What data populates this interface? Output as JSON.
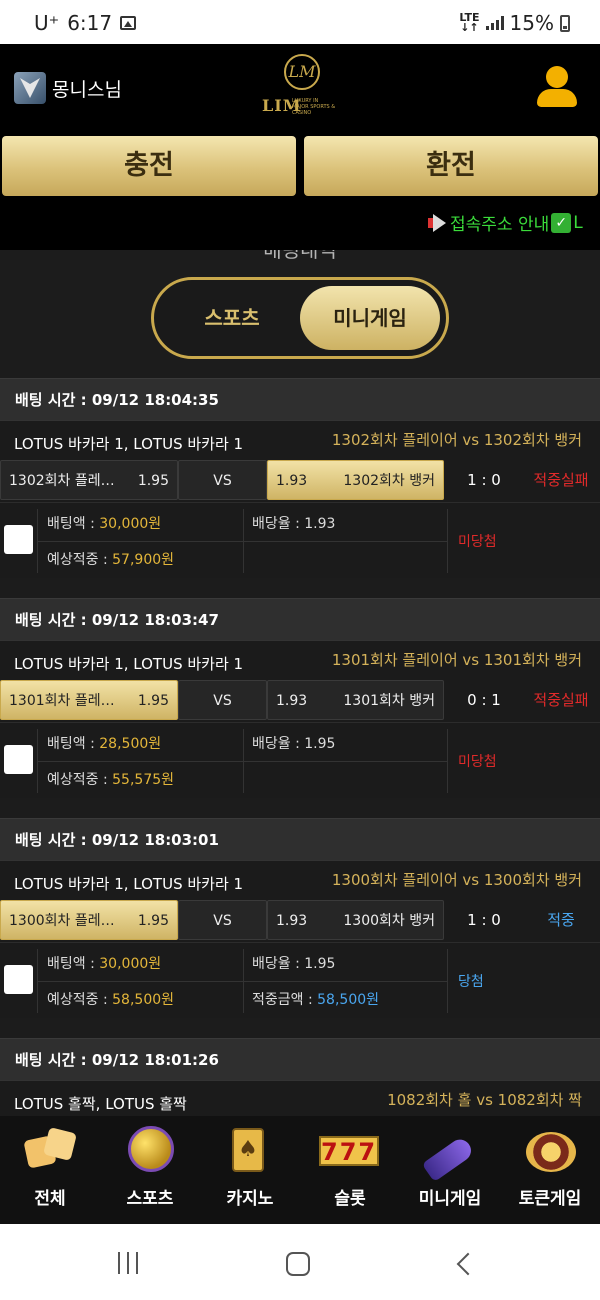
{
  "status": {
    "carrier": "U⁺",
    "time": "6:17",
    "network": "LTE",
    "battery": "15%"
  },
  "header": {
    "username": "몽니스님",
    "logo_text": "LIM",
    "logo_tag": "LUXURY IN MAJOR SPORTS & CASINO",
    "charge_label": "충전",
    "exchange_label": "환전",
    "notice": "접속주소 안내",
    "notice_tail": "L"
  },
  "section": {
    "title": "배팅내역",
    "tabs": [
      {
        "label": "스포츠",
        "active": false
      },
      {
        "label": "미니게임",
        "active": true
      }
    ]
  },
  "colors": {
    "gold": "#c9a94d",
    "fail": "#e02a2a",
    "win": "#4aa6ef",
    "amount": "#e3b63a"
  },
  "bets": [
    {
      "time": "배팅 시간 : 09/12 18:04:35",
      "game": "LOTUS 바카라 1, LOTUS 바카라 1",
      "matchup": "1302회차 플레이어  vs  1302회차 뱅커",
      "home": "1302회차 플레…",
      "home_odds": "1.95",
      "vs": "VS",
      "away_odds": "1.93",
      "away": "1302회차 뱅커",
      "selected": "away",
      "score": "1 : 0",
      "result": "적중실패",
      "result_type": "fail",
      "bet_label": "배팅액 : ",
      "bet_amount": "30,000원",
      "expected_label": "예상적중 : ",
      "expected_amount": "57,900원",
      "odds_label": "배당율 : 1.93",
      "win_label": "",
      "win_amount": "",
      "outcome": "미당첨",
      "outcome_type": "fail"
    },
    {
      "time": "배팅 시간 : 09/12 18:03:47",
      "game": "LOTUS 바카라 1, LOTUS 바카라 1",
      "matchup": "1301회차 플레이어  vs  1301회차 뱅커",
      "home": "1301회차 플레…",
      "home_odds": "1.95",
      "vs": "VS",
      "away_odds": "1.93",
      "away": "1301회차 뱅커",
      "selected": "home",
      "score": "0 : 1",
      "result": "적중실패",
      "result_type": "fail",
      "bet_label": "배팅액 : ",
      "bet_amount": "28,500원",
      "expected_label": "예상적중 : ",
      "expected_amount": "55,575원",
      "odds_label": "배당율 : 1.95",
      "win_label": "",
      "win_amount": "",
      "outcome": "미당첨",
      "outcome_type": "fail"
    },
    {
      "time": "배팅 시간 : 09/12 18:03:01",
      "game": "LOTUS 바카라 1, LOTUS 바카라 1",
      "matchup": "1300회차 플레이어  vs  1300회차 뱅커",
      "home": "1300회차 플레…",
      "home_odds": "1.95",
      "vs": "VS",
      "away_odds": "1.93",
      "away": "1300회차 뱅커",
      "selected": "home",
      "score": "1 : 0",
      "result": "적중",
      "result_type": "win",
      "bet_label": "배팅액 : ",
      "bet_amount": "30,000원",
      "expected_label": "예상적중 : ",
      "expected_amount": "58,500원",
      "odds_label": "배당율 : 1.95",
      "win_label": "적중금액 : ",
      "win_amount": "58,500원",
      "outcome": "당첨",
      "outcome_type": "win"
    }
  ],
  "partial_bet": {
    "time": "배팅 시간 : 09/12 18:01:26",
    "game": "LOTUS 홀짝, LOTUS 홀짝",
    "matchup": "1082회차 홀  vs  1082회차 짝"
  },
  "nav": [
    {
      "label": "전체",
      "icon": "dice-icon"
    },
    {
      "label": "스포츠",
      "icon": "soccer-ball-icon"
    },
    {
      "label": "카지노",
      "icon": "playing-card-icon"
    },
    {
      "label": "슬롯",
      "icon": "slot-777-icon"
    },
    {
      "label": "미니게임",
      "icon": "rocket-icon"
    },
    {
      "label": "토큰게임",
      "icon": "roulette-icon"
    }
  ],
  "slot_text": "777",
  "card_glyph": "♠"
}
